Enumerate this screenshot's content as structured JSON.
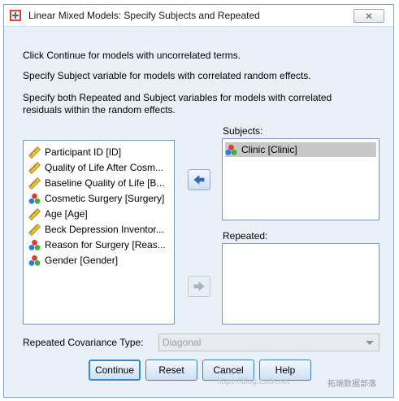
{
  "window": {
    "title": "Linear Mixed Models: Specify Subjects and Repeated",
    "close_symbol": "✕"
  },
  "instructions": [
    "Click Continue for models with uncorrelated terms.",
    "Specify Subject variable for models with correlated random effects.",
    "Specify both Repeated and Subject variables for models with correlated",
    "residuals within the random effects."
  ],
  "variables": [
    {
      "label": "Participant ID [ID]",
      "icon": "ruler-icon"
    },
    {
      "label": "Quality of Life After Cosm...",
      "icon": "ruler-icon"
    },
    {
      "label": "Baseline Quality of Life [B...",
      "icon": "ruler-icon"
    },
    {
      "label": "Cosmetic Surgery [Surgery]",
      "icon": "nominal-icon"
    },
    {
      "label": "Age [Age]",
      "icon": "ruler-icon"
    },
    {
      "label": "Beck Depression Inventor...",
      "icon": "ruler-icon"
    },
    {
      "label": "Reason for Surgery [Reas...",
      "icon": "nominal-icon"
    },
    {
      "label": "Gender [Gender]",
      "icon": "nominal-icon"
    }
  ],
  "subjects": {
    "label": "Subjects:",
    "items": [
      {
        "label": "Clinic [Clinic]",
        "icon": "nominal-icon",
        "selected": true
      }
    ]
  },
  "repeated": {
    "label": "Repeated:",
    "items": []
  },
  "covariance": {
    "label": "Repeated Covariance Type:",
    "value": "Diagonal",
    "enabled": false
  },
  "buttons": {
    "continue": "Continue",
    "reset": "Reset",
    "cancel": "Cancel",
    "help": "Help"
  },
  "watermark": {
    "url": "https://blog.csdn.net",
    "text": "拓端数据部落"
  },
  "colors": {
    "accent": "#3a88c8",
    "dialog_bg": "#eaf0f8",
    "selection": "#c8c8c8"
  }
}
